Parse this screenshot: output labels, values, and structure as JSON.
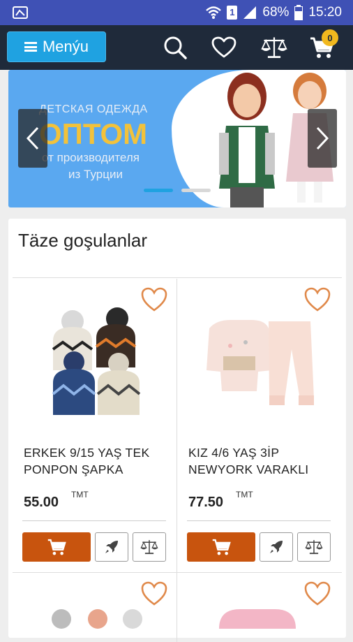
{
  "status_bar": {
    "battery": "68%",
    "time": "15:20",
    "sim": "1"
  },
  "app_bar": {
    "menu_label": "Menýu",
    "cart_count": "0",
    "icons": [
      "search-icon",
      "heart-icon",
      "scale-icon",
      "cart-icon"
    ]
  },
  "banner": {
    "line1": "ДЕТСКАЯ ОДЕЖДА",
    "title": "ОПТОМ",
    "line2": "от производителя",
    "line3": "из Турции",
    "active_slide": 1,
    "slide_count": 2
  },
  "section": {
    "title": "Täze goşulanlar"
  },
  "products": [
    {
      "name_line1": "ERKEK 9/15 YAŞ TEK",
      "name_line2": "PONPON ŞAPKA",
      "price": "55.00",
      "currency": "TMT"
    },
    {
      "name_line1": "KIZ 4/6 YAŞ 3İP",
      "name_line2": "NEWYORK VARAKLI",
      "price": "77.50",
      "currency": "TMT"
    }
  ],
  "colors": {
    "status_bar": "#3f51b5",
    "app_bar": "#1f2a3a",
    "menu_button": "#1fa2e1",
    "cart_badge": "#f1b81e",
    "add_to_cart": "#c8540e",
    "heart_outline": "#e0894a"
  }
}
